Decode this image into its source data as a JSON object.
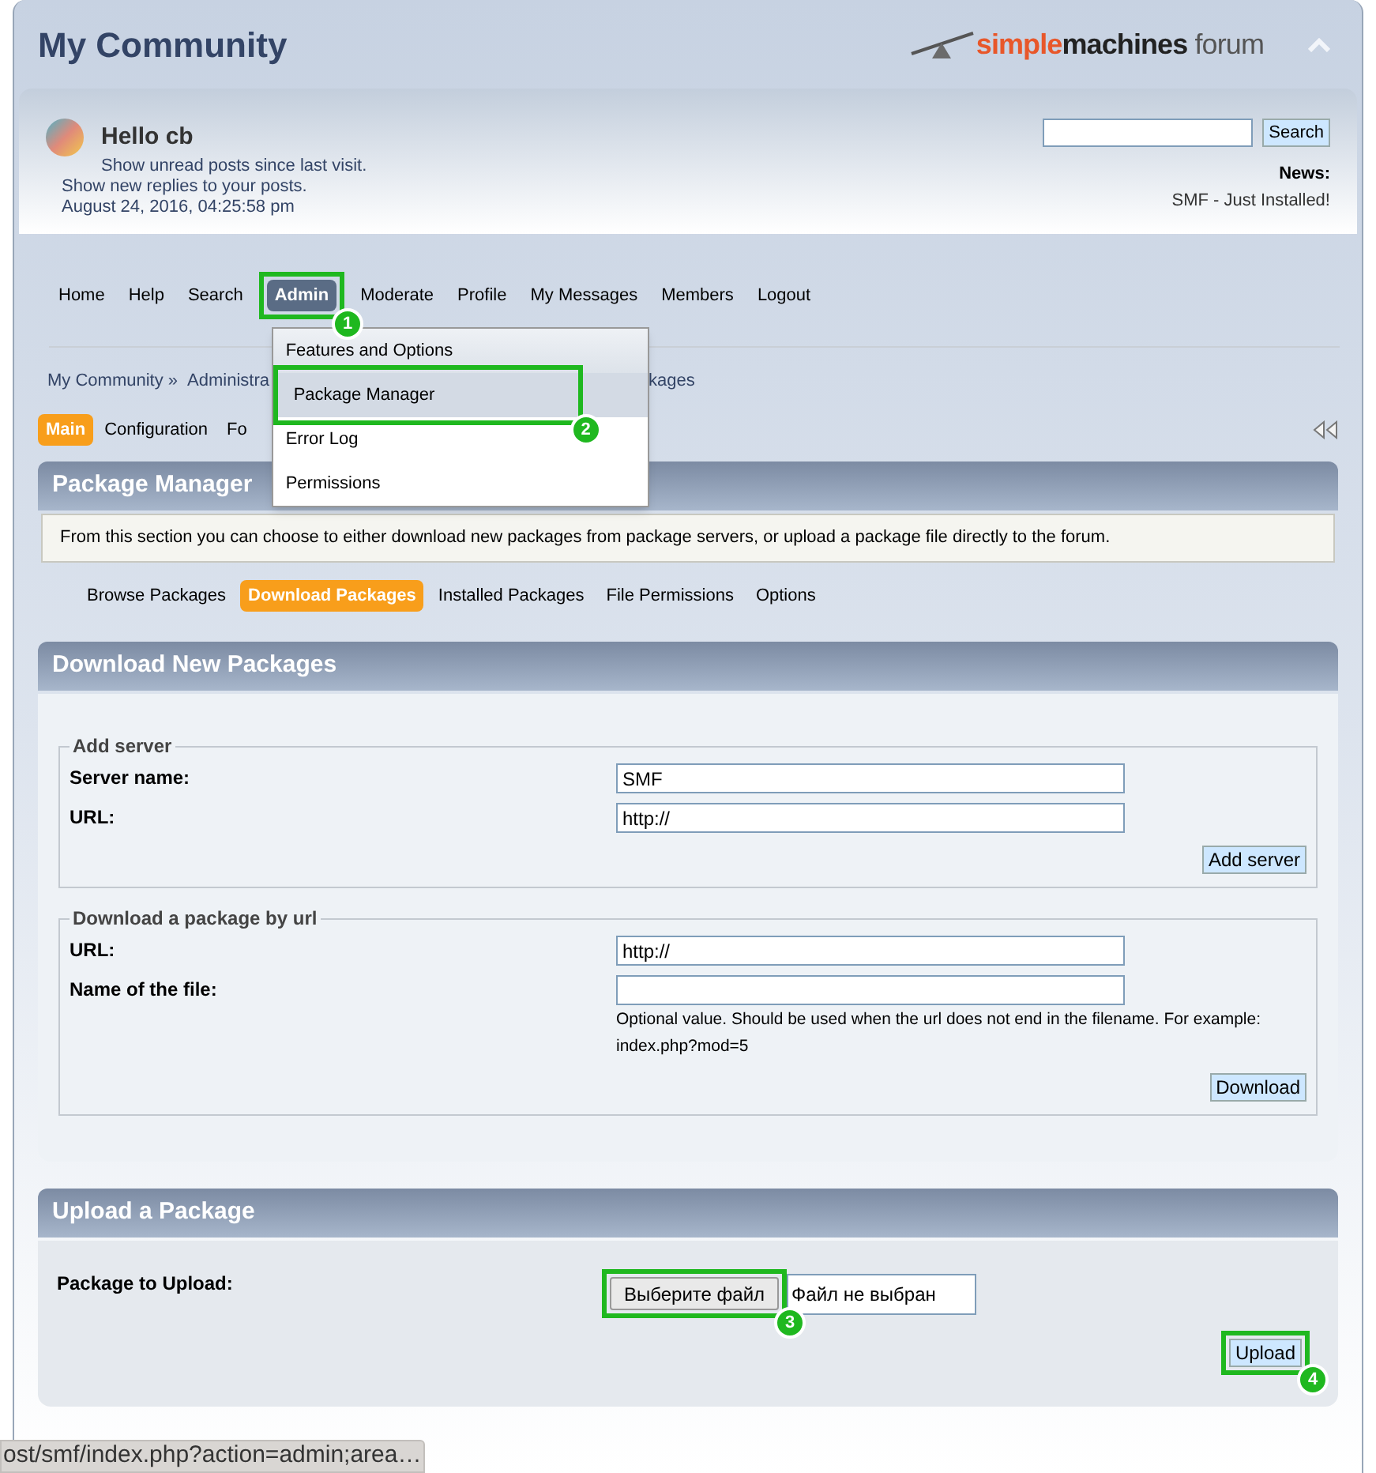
{
  "header": {
    "title": "My Community",
    "logo": {
      "part_1": "simple",
      "part_2": "machines",
      "part_3": "forum"
    }
  },
  "user": {
    "greeting": "Hello cb",
    "lines": [
      "Show unread posts since last visit.",
      "Show new replies to your posts.",
      "August 24, 2016, 04:25:58 pm"
    ]
  },
  "search": {
    "button": "Search"
  },
  "news": {
    "heading": "News:",
    "text": "SMF - Just Installed!"
  },
  "main_menu": [
    {
      "label": "Home",
      "selected": false
    },
    {
      "label": "Help",
      "selected": false
    },
    {
      "label": "Search",
      "selected": false
    },
    {
      "label": "Admin",
      "selected": true,
      "callout": "1"
    },
    {
      "label": "Moderate",
      "selected": false
    },
    {
      "label": "Profile",
      "selected": false
    },
    {
      "label": "My Messages",
      "selected": false
    },
    {
      "label": "Members",
      "selected": false
    },
    {
      "label": "Logout",
      "selected": false
    }
  ],
  "admin_dropdown": [
    {
      "label": "Features and Options",
      "selected": false
    },
    {
      "label": "Package Manager",
      "selected": true,
      "callout": "2"
    },
    {
      "label": "Error Log",
      "selected": false
    },
    {
      "label": "Permissions",
      "selected": false
    }
  ],
  "breadcrumb": [
    "My Community »",
    "Administra",
    "kages"
  ],
  "admin_tabs": [
    {
      "label": "Main",
      "selected": true
    },
    {
      "label": "Configuration",
      "selected": false
    },
    {
      "label": "Fo",
      "selected": false
    }
  ],
  "package_manager": {
    "title": "Package Manager",
    "description": "From this section you can choose to either download new packages from package servers, or upload a package file directly to the forum.",
    "tabs": [
      {
        "label": "Browse Packages",
        "selected": false
      },
      {
        "label": "Download Packages",
        "selected": true
      },
      {
        "label": "Installed Packages",
        "selected": false
      },
      {
        "label": "File Permissions",
        "selected": false
      },
      {
        "label": "Options",
        "selected": false
      }
    ]
  },
  "download_section": {
    "title": "Download New Packages",
    "add_server": {
      "legend": "Add server",
      "fields": [
        {
          "label": "Server name:",
          "value": "SMF"
        },
        {
          "label": "URL:",
          "value": "http://"
        }
      ],
      "button": "Add server"
    },
    "by_url": {
      "legend": "Download a package by url",
      "fields": [
        {
          "label": "URL:",
          "value": "http://"
        },
        {
          "label": "Name of the file:",
          "note": "Optional value. Should be used when the url does not end in the filename. For example: index.php?mod=5"
        }
      ],
      "button": "Download"
    }
  },
  "upload_section": {
    "title": "Upload a Package",
    "label": "Package to Upload:",
    "file_button": "Выберите файл",
    "file_button_callout": "3",
    "file_status": "Файл не выбран",
    "button": "Upload",
    "button_callout": "4"
  },
  "status_bar": {
    "url": "ost/smf/index.php?action=admin;area…"
  }
}
